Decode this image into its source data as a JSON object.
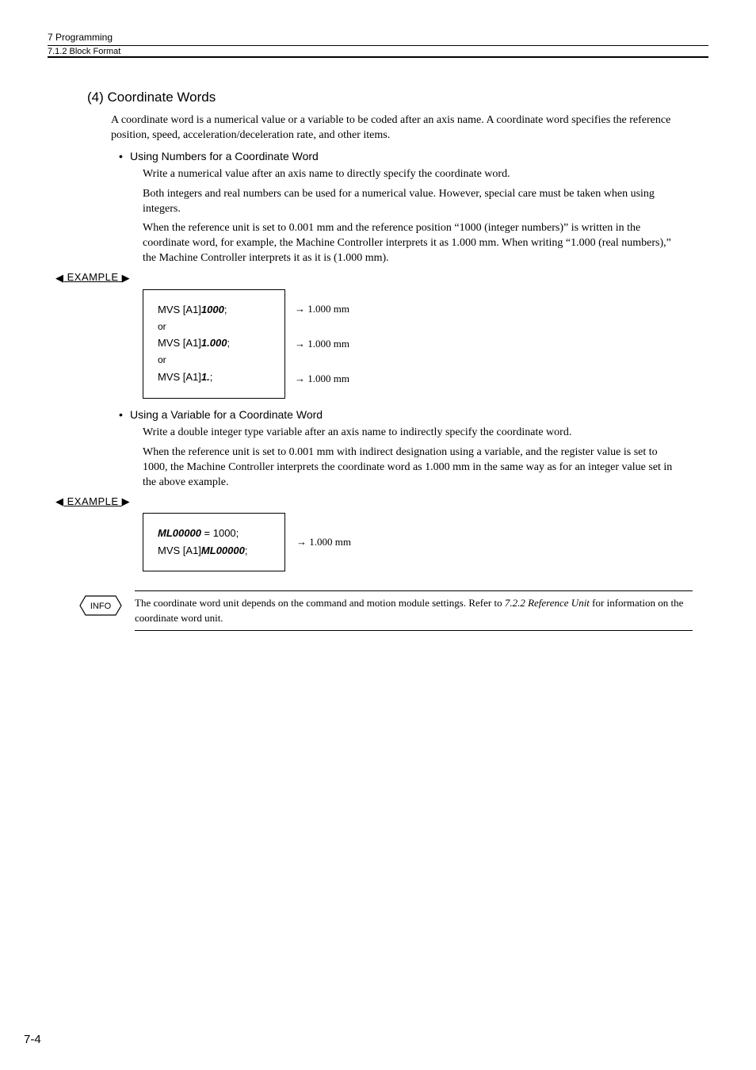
{
  "header": {
    "chapter": "7  Programming",
    "section": "7.1.2  Block Format"
  },
  "section_heading": "(4) Coordinate Words",
  "intro": "A coordinate word is a numerical value or a variable to be coded after an axis name. A coordinate word specifies the reference position, speed, acceleration/deceleration rate, and other items.",
  "sub1": {
    "title": "Using Numbers for a Coordinate Word",
    "p1": "Write a numerical value after an axis name to directly specify the coordinate word.",
    "p2": "Both integers and real numbers can be used for a numerical value. However, special care must be taken when using integers.",
    "p3": "When the reference unit is set to 0.001 mm and the reference position “1000 (integer numbers)” is written in the coordinate word, for example, the Machine Controller interprets it as 1.000 mm. When writing “1.000 (real numbers),” the Machine Controller interprets it as it is (1.000 mm)."
  },
  "example_label": "EXAMPLE",
  "example1": {
    "lines": [
      {
        "prefix": "MVS  [A1]",
        "bold": "1000",
        "suffix": ";"
      },
      {
        "or": "or"
      },
      {
        "prefix": "MVS  [A1]",
        "bold": "1.000",
        "suffix": ";"
      },
      {
        "or": "or"
      },
      {
        "prefix": "MVS  [A1]",
        "bold": "1.",
        "suffix": ";"
      }
    ],
    "results": [
      "→  1.000 mm",
      "→  1.000 mm",
      "→  1.000 mm"
    ]
  },
  "sub2": {
    "title": "Using a Variable for a Coordinate Word",
    "p1": "Write a double integer type variable after an axis name to indirectly specify the coordinate word.",
    "p2": "When the reference unit is set to 0.001 mm with indirect designation using a variable, and the register value is set to 1000, the Machine Controller interprets the coordinate word as 1.000 mm in the same way as for an integer value set in the above example."
  },
  "example2": {
    "lines": [
      {
        "bold": "ML00000",
        "suffix": " = 1000;"
      },
      {
        "prefix": "MVS  [A1]",
        "bold": "ML00000",
        "suffix": ";"
      }
    ],
    "result": "→  1.000 mm"
  },
  "info": {
    "label": "INFO",
    "text_pre": "The coordinate word unit depends on the command and motion module settings. Refer to ",
    "text_ref": "7.2.2 Reference Unit",
    "text_post": " for information on the coordinate word unit."
  },
  "page_number": "7-4"
}
